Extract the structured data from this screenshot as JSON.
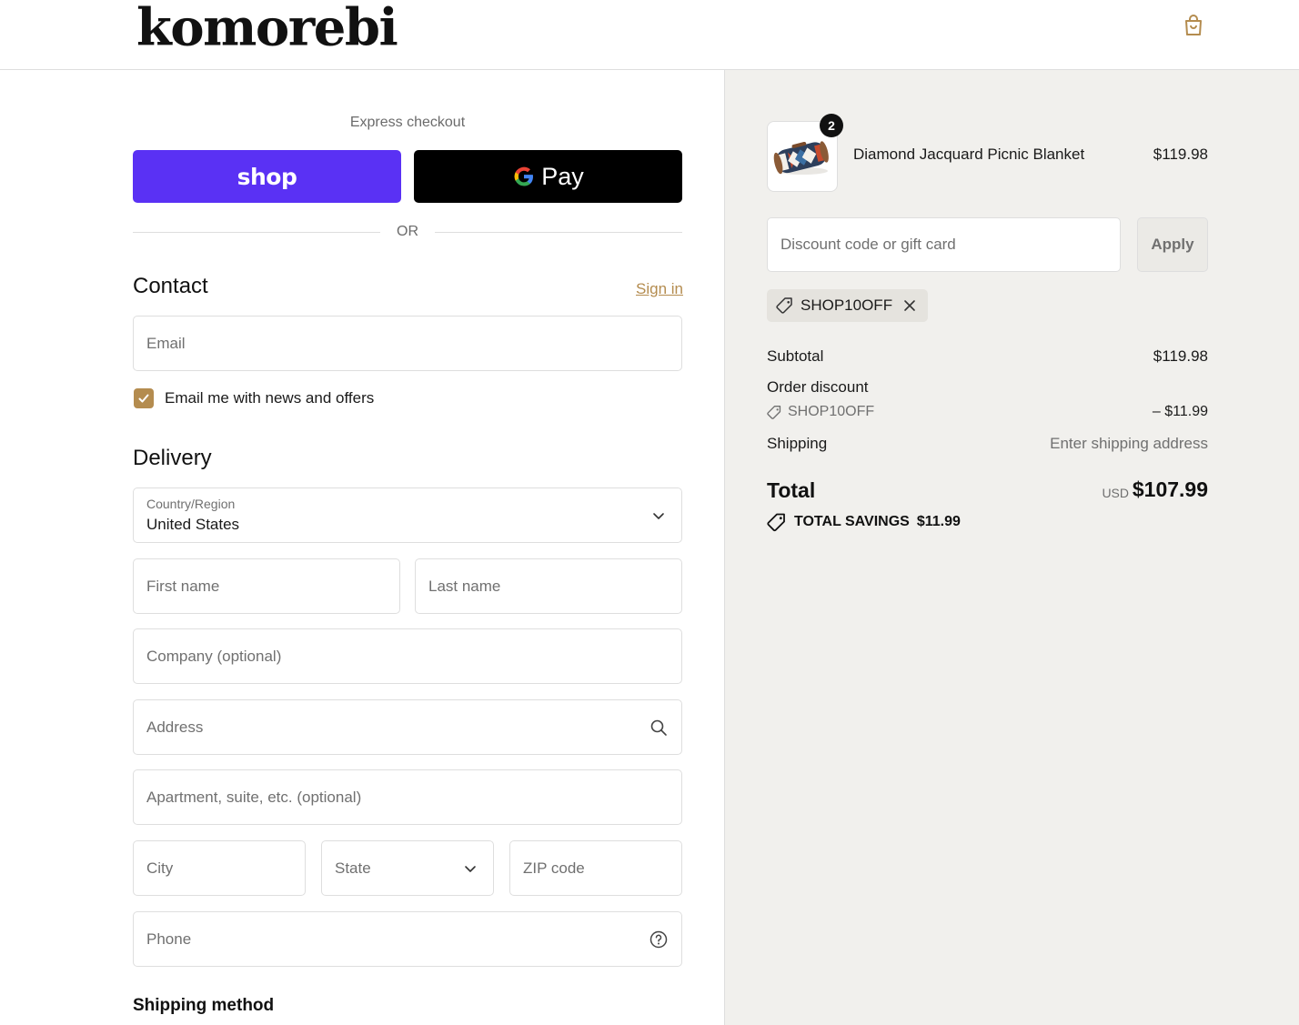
{
  "brand": {
    "logo": "komorebi",
    "registered": "®"
  },
  "express": {
    "label": "Express checkout",
    "shop_label": "shop",
    "gpay_label": "Pay",
    "or_label": "OR"
  },
  "contact": {
    "title": "Contact",
    "signin": "Sign in",
    "email_placeholder": "Email",
    "newsletter_label": "Email me with news and offers",
    "newsletter_checked": true
  },
  "delivery": {
    "title": "Delivery",
    "country_label": "Country/Region",
    "country_value": "United States",
    "first_name": "First name",
    "last_name": "Last name",
    "company": "Company (optional)",
    "address": "Address",
    "apartment": "Apartment, suite, etc. (optional)",
    "city": "City",
    "state": "State",
    "zip": "ZIP code",
    "phone": "Phone"
  },
  "shipping_method": {
    "title": "Shipping method"
  },
  "cart": {
    "item": {
      "name": "Diamond Jacquard Picnic Blanket",
      "price": "$119.98",
      "quantity": "2"
    },
    "discount_placeholder": "Discount code or gift card",
    "apply_label": "Apply",
    "applied_code": "SHOP10OFF",
    "subtotal_label": "Subtotal",
    "subtotal_value": "$119.98",
    "order_discount_label": "Order discount",
    "order_discount_code": "SHOP10OFF",
    "order_discount_value": "– $11.99",
    "shipping_label": "Shipping",
    "shipping_value": "Enter shipping address",
    "total_label": "Total",
    "total_currency": "USD",
    "total_value": "$107.99",
    "savings_label": "TOTAL SAVINGS",
    "savings_value": "$11.99"
  },
  "colors": {
    "accent": "#b48c4f",
    "shop_purple": "#5a31f4",
    "sidebar_bg": "#f1f0ed"
  }
}
